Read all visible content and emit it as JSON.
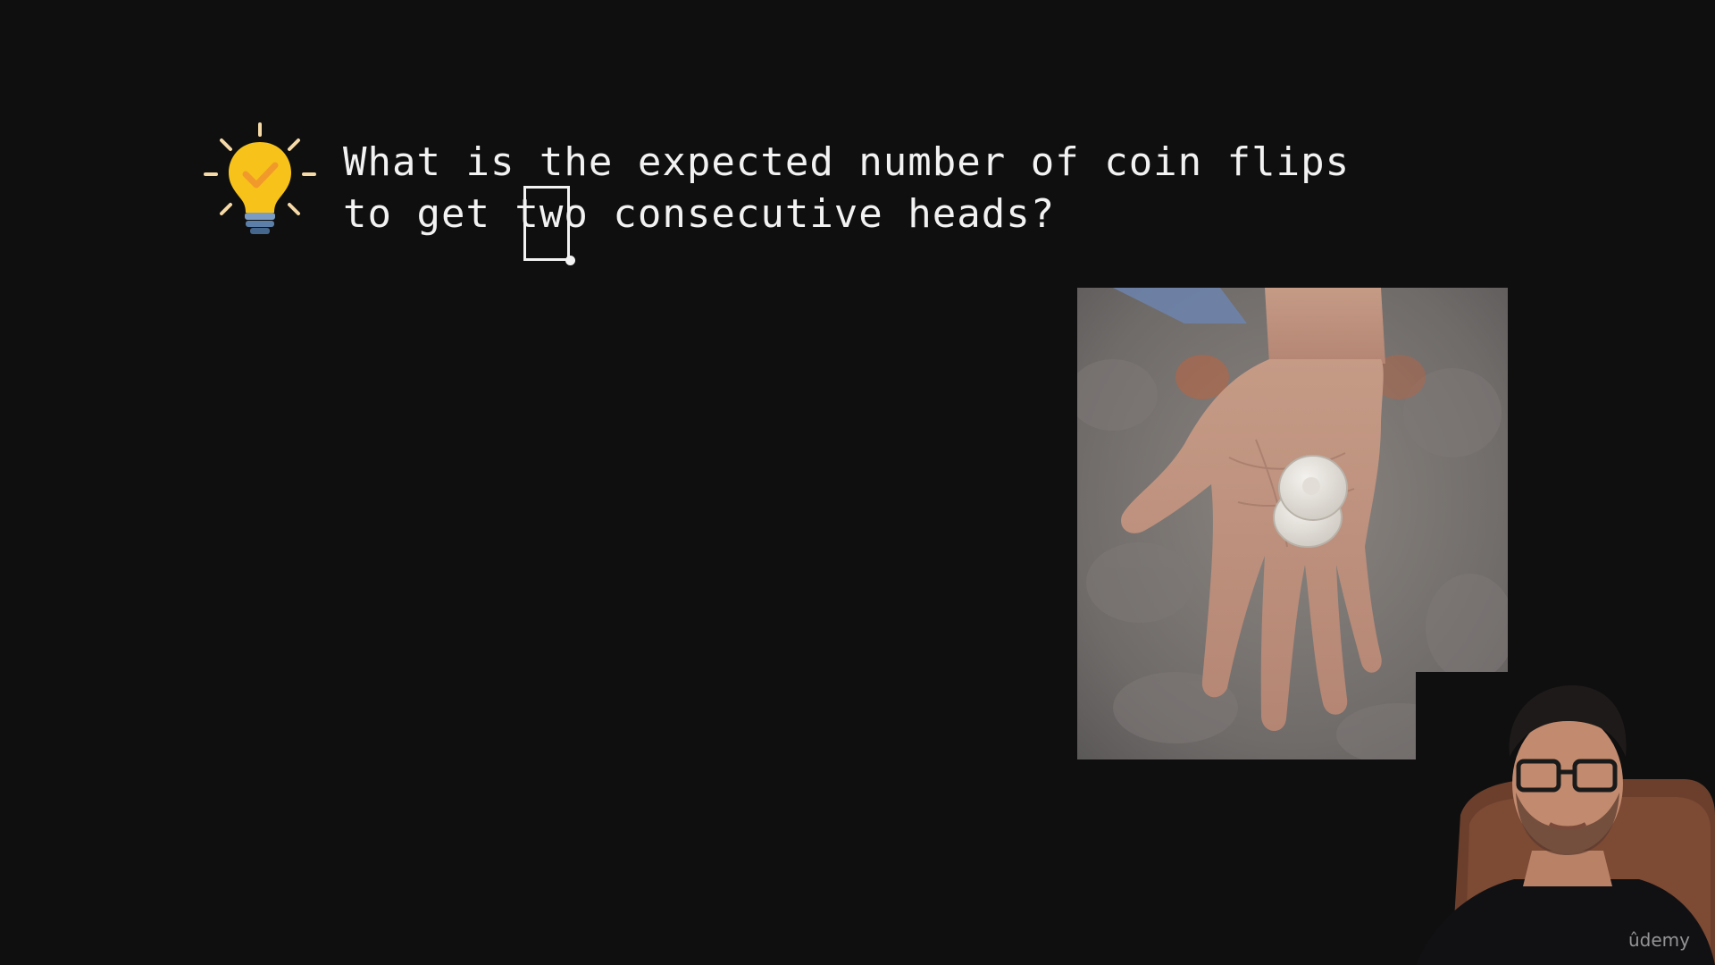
{
  "question": {
    "line1": "What is the expected number of coin flips",
    "line2": "to get two consecutive heads?"
  },
  "icons": {
    "bulb": "lightbulb-check-icon"
  },
  "images": {
    "photo": "hand holding two coins",
    "webcam": "presenter"
  },
  "watermark": "ûdemy",
  "colors": {
    "background": "#0f0f0f",
    "text": "#f2f2f2",
    "bulb": "#f7c21a",
    "check": "#f19a2b",
    "bulb_base": "#5b7fa8",
    "rays": "#f5d9a6"
  }
}
